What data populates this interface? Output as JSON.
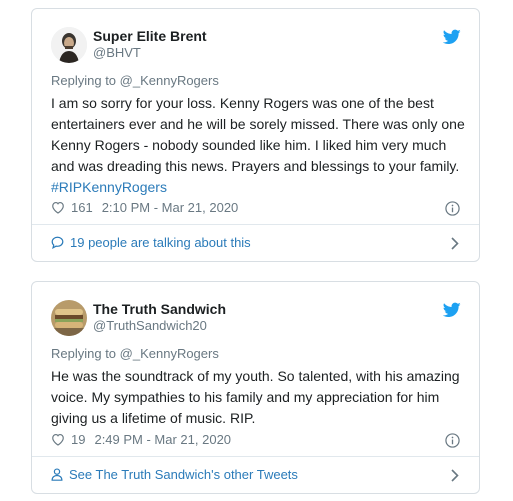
{
  "tweets": [
    {
      "author_name": "Super Elite Brent",
      "handle": "@BHVT",
      "replying_to": "Replying to @_KennyRogers",
      "text": "I am so sorry for your loss.  Kenny Rogers was one of the best entertainers ever and he will be sorely missed.  There was only one Kenny Rogers - nobody sounded like him.  I liked him very much and was dreading this news.  Prayers and blessings to your family. ",
      "hashtag": "#RIPKennyRogers",
      "likes": "161",
      "timestamp": "2:10 PM - Mar 21, 2020",
      "footer_text": "19 people are talking about this",
      "footer_icon": "speech-bubble-icon"
    },
    {
      "author_name": "The Truth Sandwich",
      "handle": "@TruthSandwich20",
      "replying_to": "Replying to @_KennyRogers",
      "text": "He was the soundtrack of my youth. So talented, with his amazing voice. My sympathies to his family and my appreciation for him giving us a lifetime of music. RIP.",
      "likes": "19",
      "timestamp": "2:49 PM - Mar 21, 2020",
      "footer_text": "See The Truth Sandwich's other Tweets",
      "footer_icon": "person-icon"
    }
  ],
  "colors": {
    "link": "#2b7bb9",
    "twitter_blue": "#1da1f2",
    "muted": "#697882",
    "border": "#d8dee3"
  }
}
